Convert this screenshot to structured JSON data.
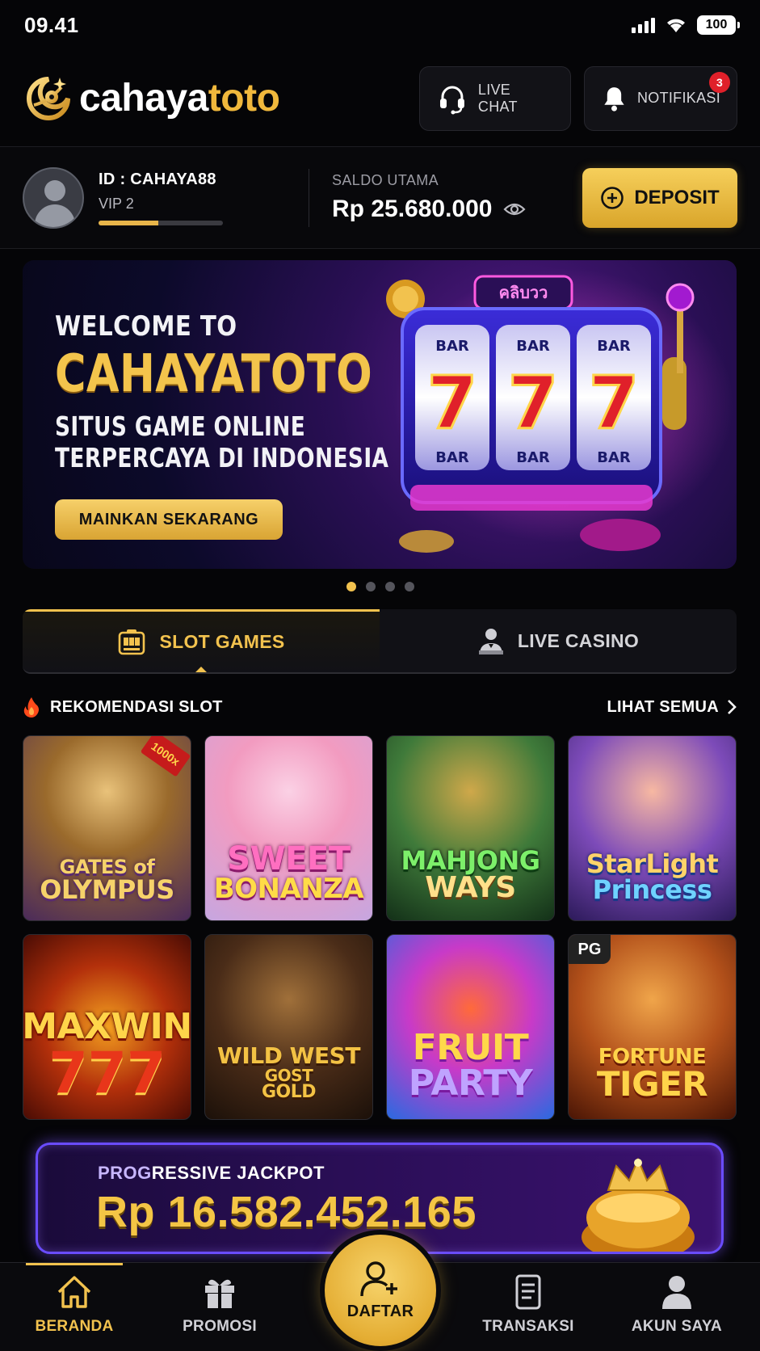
{
  "status_bar": {
    "time": "09.41",
    "battery": "100"
  },
  "header": {
    "logo_white": "cahaya",
    "logo_gold": "toto",
    "live_chat_label": "LIVE CHAT",
    "notif_label": "NOTIFIKASI",
    "notif_count": "3"
  },
  "account": {
    "id_text": "ID : CAHAYA88",
    "vip_text": "VIP 2",
    "vip_progress_pct": 48,
    "saldo_label": "SALDO UTAMA",
    "saldo_value": "Rp 25.680.000",
    "deposit_label": "DEPOSIT"
  },
  "banner": {
    "line1": "WELCOME TO",
    "line2": "CAHAYATOTO",
    "line3": "SITUS GAME ONLINE",
    "line4": "TERPERCAYA DI INDONESIA",
    "cta": "MAINKAN SEKARANG",
    "slot_top_sign": "คลิบวว",
    "reel_top": [
      "BAR",
      "BAR",
      "BAR"
    ],
    "reel_mid": [
      "7",
      "7",
      "7"
    ],
    "reel_bot": [
      "BAR",
      "BAR",
      "BAR"
    ],
    "dots_total": 4,
    "dots_active": 0
  },
  "tabs": [
    {
      "label": "SLOT GAMES",
      "active": true,
      "icon": "slot-machine-icon"
    },
    {
      "label": "LIVE CASINO",
      "active": false,
      "icon": "dealer-icon"
    }
  ],
  "section": {
    "title": "REKOMENDASI SLOT",
    "more": "LIHAT SEMUA"
  },
  "games": [
    {
      "name": "gates-of-olympus",
      "line1": "GATES of",
      "line2": "OLYMPUS",
      "ribbon": "1000x"
    },
    {
      "name": "sweet-bonanza",
      "line1": "SWEET",
      "line2": "BONANZA"
    },
    {
      "name": "mahjong-ways",
      "line1": "MAHJONG",
      "line2": "WAYS"
    },
    {
      "name": "starlight-princess",
      "line1": "StarLight",
      "line2": "Princess"
    },
    {
      "name": "maxwin-777",
      "line1": "MAXWIN",
      "line2": "777"
    },
    {
      "name": "wild-west-gold",
      "line1": "WILD WEST",
      "line2": "GOST",
      "line3": "GOLD"
    },
    {
      "name": "fruit-party",
      "line1": "FRUIT",
      "line2": "PARTY"
    },
    {
      "name": "fortune-tiger",
      "line1": "FORTUNE",
      "line2": "TIGER",
      "tag": "PG"
    }
  ],
  "jackpot": {
    "label_a": "PROG",
    "label_b": "RESSIVE JACKPOT",
    "value": "Rp 16.582.452.165"
  },
  "bottom_nav": {
    "home": "BERANDA",
    "promo": "PROMOSI",
    "daftar": "DAFTAR",
    "transaksi": "TRANSAKSI",
    "akun": "AKUN SAYA"
  },
  "colors": {
    "gold": "#f2c24e",
    "bg": "#050507",
    "jackpot_border": "#6a4cff",
    "badge": "#e0202a"
  }
}
